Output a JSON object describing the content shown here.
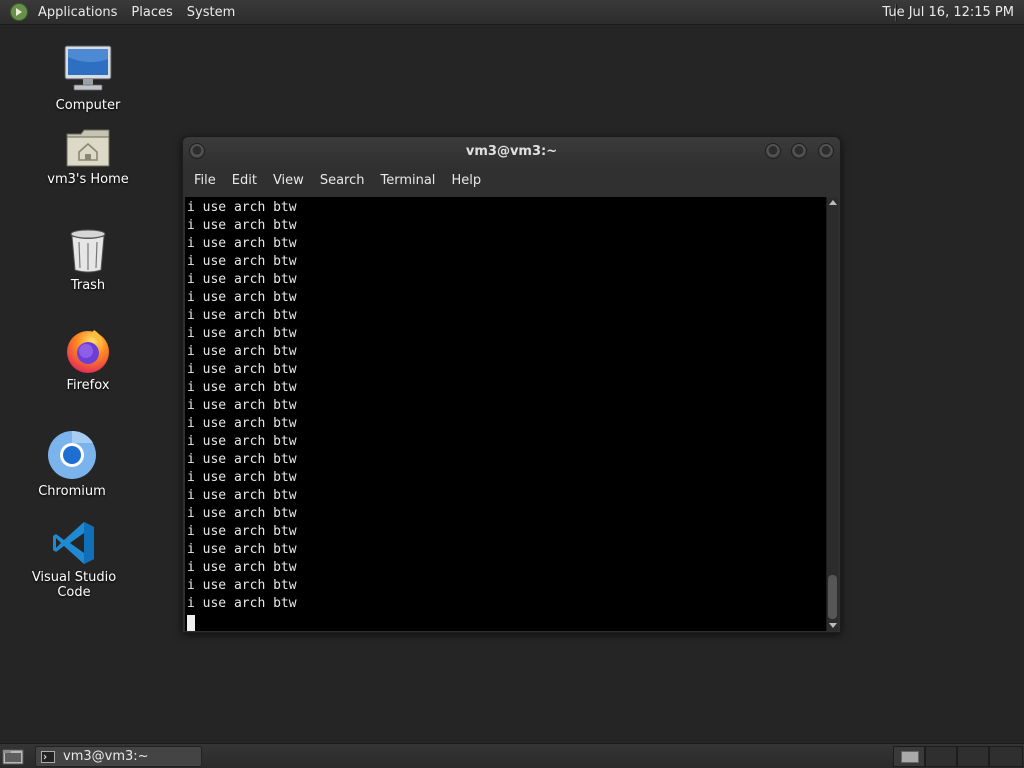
{
  "top_panel": {
    "menus": [
      "Applications",
      "Places",
      "System"
    ],
    "clock": "Tue Jul 16, 12:15 PM"
  },
  "desktop_icons": [
    {
      "label": "Computer",
      "icon": "computer-icon"
    },
    {
      "label": "vm3's Home",
      "icon": "home-folder-icon"
    },
    {
      "label": "Trash",
      "icon": "trash-icon"
    },
    {
      "label": "Firefox",
      "icon": "firefox-icon"
    },
    {
      "label": "Chromium",
      "icon": "chromium-icon"
    },
    {
      "label": "Visual Studio Code",
      "icon": "vscode-icon"
    }
  ],
  "terminal": {
    "title": "vm3@vm3:~",
    "menu": [
      "File",
      "Edit",
      "View",
      "Search",
      "Terminal",
      "Help"
    ],
    "lines": [
      "i use arch btw",
      "i use arch btw",
      "i use arch btw",
      "i use arch btw",
      "i use arch btw",
      "i use arch btw",
      "i use arch btw",
      "i use arch btw",
      "i use arch btw",
      "i use arch btw",
      "i use arch btw",
      "i use arch btw",
      "i use arch btw",
      "i use arch btw",
      "i use arch btw",
      "i use arch btw",
      "i use arch btw",
      "i use arch btw",
      "i use arch btw",
      "i use arch btw",
      "i use arch btw",
      "i use arch btw",
      "i use arch btw"
    ]
  },
  "taskbar": {
    "tasks": [
      {
        "label": "vm3@vm3:~",
        "icon": "terminal-icon"
      }
    ],
    "workspaces": 4,
    "active_workspace": 1
  },
  "colors": {
    "desktop_bg": "#252525",
    "panel_bg": "#2f2f2f",
    "terminal_bg": "#000000",
    "terminal_fg": "#e8e8e8"
  }
}
